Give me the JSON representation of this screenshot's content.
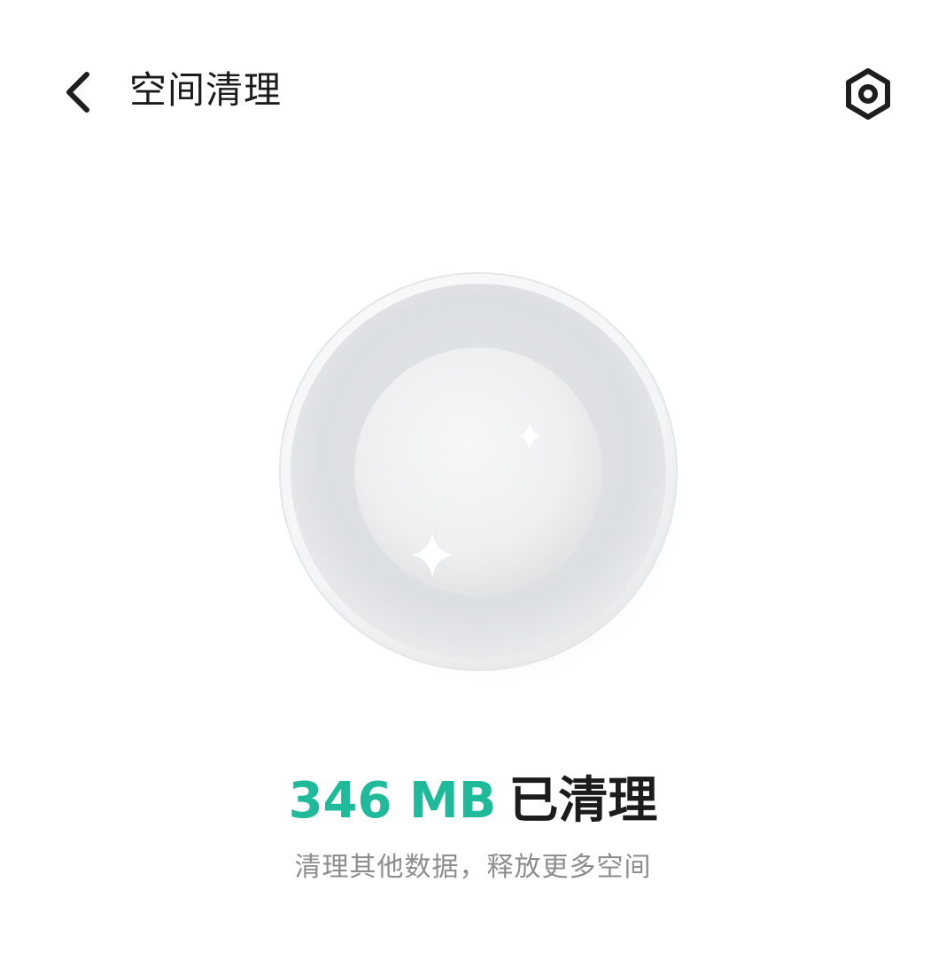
{
  "header": {
    "title": "空间清理",
    "back_icon": "chevron-left-icon",
    "settings_icon": "settings-hex-icon"
  },
  "result": {
    "amount": "346 MB",
    "suffix": "已清理"
  },
  "hint": "清理其他数据，释放更多空间",
  "colors": {
    "accent": "#1fba9a",
    "title_text": "#1b1b1b",
    "hint_text": "#8d8d8d"
  }
}
